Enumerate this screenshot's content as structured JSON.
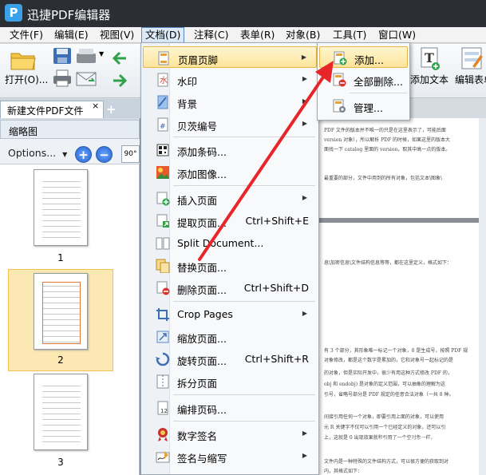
{
  "window": {
    "title": "迅捷PDF编辑器",
    "logo_letter": "P"
  },
  "menubar": [
    "文件(F)",
    "编辑(E)",
    "视图(V)",
    "文档(D)",
    "注释(C)",
    "表单(R)",
    "对象(B)",
    "工具(T)",
    "窗口(W)"
  ],
  "toolbar": {
    "open_label": "打开(O)...",
    "add_text_label": "添加文本",
    "edit_form_label": "编辑表单"
  },
  "tab": {
    "name": "新建文件PDF文件",
    "close": "×",
    "new": "+"
  },
  "thumbnails": {
    "header": "缩略图",
    "options_label": "Options...",
    "zoom_in": "+",
    "zoom_out": "−",
    "rotate_label": "90°",
    "pages": [
      "1",
      "2",
      "3"
    ],
    "selected_page": "2"
  },
  "document_menu": [
    {
      "label": "页眉页脚",
      "icon": "header-footer-icon",
      "submenu": true,
      "highlighted": true
    },
    {
      "label": "水印",
      "icon": "watermark-icon",
      "submenu": true
    },
    {
      "label": "背景",
      "icon": "background-icon",
      "submenu": true
    },
    {
      "label": "贝茨编号",
      "icon": "bates-number-icon",
      "submenu": true
    },
    {
      "label": "添加条码...",
      "icon": "barcode-icon"
    },
    {
      "label": "添加图像...",
      "icon": "add-image-icon"
    },
    {
      "label": "插入页面",
      "icon": "insert-page-icon",
      "submenu": true
    },
    {
      "label": "提取页面...",
      "icon": "extract-page-icon",
      "shortcut": "Ctrl+Shift+E"
    },
    {
      "label": "Split Document...",
      "icon": "split-document-icon"
    },
    {
      "label": "替换页面...",
      "icon": "replace-page-icon"
    },
    {
      "label": "删除页面...",
      "icon": "delete-page-icon",
      "shortcut": "Ctrl+Shift+D"
    },
    {
      "label": "Crop Pages",
      "icon": "crop-pages-icon",
      "submenu": true
    },
    {
      "label": "缩放页面...",
      "icon": "resize-page-icon"
    },
    {
      "label": "旋转页面...",
      "icon": "rotate-page-icon",
      "shortcut": "Ctrl+Shift+R"
    },
    {
      "label": "拆分页面",
      "icon": "split-page-icon"
    },
    {
      "label": "编排页码...",
      "icon": "page-numbering-icon"
    },
    {
      "label": "数字签名",
      "icon": "digital-signature-icon",
      "submenu": true
    },
    {
      "label": "签名与缩写",
      "icon": "sign-initials-icon",
      "submenu": true
    }
  ],
  "header_footer_submenu": [
    {
      "label": "添加...",
      "icon": "add-header-icon",
      "highlighted": true
    },
    {
      "label": "全部删除...",
      "icon": "remove-all-header-icon"
    },
    {
      "label": "管理...",
      "icon": "manage-header-icon"
    }
  ],
  "page_text": [
    "PDF 文件的版本并不唯一的只是在这里表示了，可能后面",
    "version 对象），所以解析 PDF 的时候，如果这里的版本大",
    "面找一下 catalog 里面的 version，取其中高一点的版本。",
    "最重要的部分，文件中用到的所有对象，包括文本\\图象\\",
    "息\\加密信息\\文件结构信息等等，都在这里定义，格式如下：",
    "有 3 个部分，其形象唯一标记一个对象，0 是生成号，按照 PDF 规",
    "对象修改，都是这个数字是累加的，它和对象号一起标记的是",
    "的对象，但是实际开发中，很少有用这种方式修改 PDF 的，",
    "obj 和 endobj) 是对象的定义范围，可以抽象的理解为这",
    "引号，省略号部分是 PDF 规定的任意合法对象（一共 8 种。",
    "间接引用任何一个对象，即要引用上面的对象，可以使用",
    "元 R 关键字不仅可以引用一个已经定义的对象，还可以引",
    "上，这就是 0 出现效果就和引用了一个空对象一样。",
    "文件内是一种特殊的文件结构方式，可以很方便的获取到对",
    "内，其格式如下："
  ],
  "watermark": "Bai经验"
}
